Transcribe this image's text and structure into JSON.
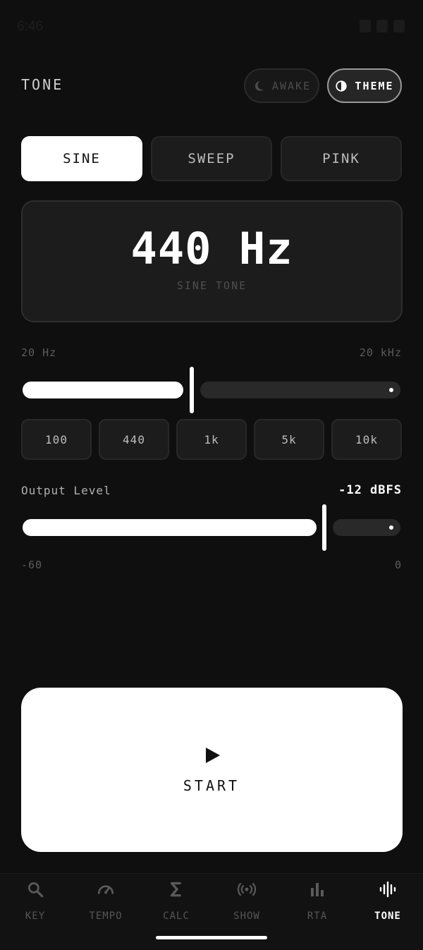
{
  "status_bar": {
    "time": "6:46"
  },
  "header": {
    "title": "TONE",
    "awake_label": "AWAKE",
    "theme_label": "THEME"
  },
  "modes": [
    {
      "label": "SINE",
      "selected": true
    },
    {
      "label": "SWEEP",
      "selected": false
    },
    {
      "label": "PINK",
      "selected": false
    }
  ],
  "frequency": {
    "value": "440 Hz",
    "subtitle": "SINE TONE",
    "min_label": "20 Hz",
    "max_label": "20 kHz",
    "slider_fraction": 0.44
  },
  "presets": [
    "100",
    "440",
    "1k",
    "5k",
    "10k"
  ],
  "output": {
    "label": "Output Level",
    "value": "-12 dBFS",
    "min_label": "-60",
    "max_label": "0",
    "slider_fraction": 0.8
  },
  "start_button": {
    "label": "START"
  },
  "nav": [
    {
      "label": "KEY",
      "icon": "search-icon",
      "active": false
    },
    {
      "label": "TEMPO",
      "icon": "gauge-icon",
      "active": false
    },
    {
      "label": "CALC",
      "icon": "sigma-icon",
      "active": false
    },
    {
      "label": "SHOW",
      "icon": "broadcast-icon",
      "active": false
    },
    {
      "label": "RTA",
      "icon": "bar-chart-icon",
      "active": false
    },
    {
      "label": "TONE",
      "icon": "waveform-icon",
      "active": true
    }
  ],
  "colors": {
    "background": "#0f0f0f",
    "accent": "#ffffff",
    "card": "#1c1c1c",
    "inactive": "#565656"
  }
}
